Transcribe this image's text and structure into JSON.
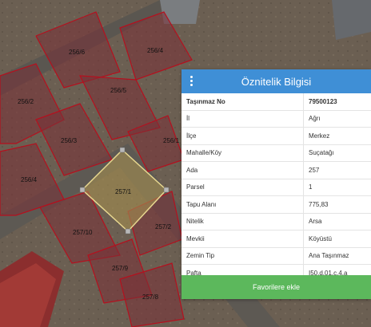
{
  "map": {
    "parcel_labels": [
      "256/6",
      "256/4",
      "256/5",
      "256/2",
      "256/3",
      "256/1",
      "256/4",
      "257/1",
      "257/10",
      "257/2",
      "257/9",
      "257/8"
    ]
  },
  "panel": {
    "title": "Öznitelik Bilgisi",
    "rows": [
      {
        "key": "Taşınmaz No",
        "value": "79500123"
      },
      {
        "key": "İl",
        "value": "Ağrı"
      },
      {
        "key": "İlçe",
        "value": "Merkez"
      },
      {
        "key": "Mahalle/Köy",
        "value": "Suçatağı"
      },
      {
        "key": "Ada",
        "value": "257"
      },
      {
        "key": "Parsel",
        "value": "1"
      },
      {
        "key": "Tapu Alanı",
        "value": "775,83"
      },
      {
        "key": "Nitelik",
        "value": "Arsa"
      },
      {
        "key": "Mevkii",
        "value": "Köyüstü"
      },
      {
        "key": "Zemin Tip",
        "value": "Ana Taşınmaz"
      },
      {
        "key": "Pafta",
        "value": "I50.d.01.c.4.a"
      }
    ],
    "button_label": "Favorilere ekle"
  },
  "colors": {
    "header": "#3f8fd6",
    "button": "#5cb85c",
    "parcel_fill": "#7a2f36",
    "parcel_border": "#b5101e",
    "selected_parcel": "#a08a50"
  }
}
